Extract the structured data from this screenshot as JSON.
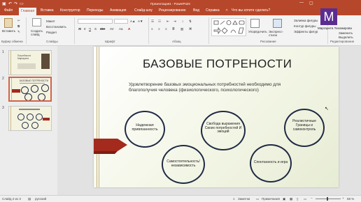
{
  "window": {
    "title": "Презентация1 - PowerPoint",
    "user": "Маргарита Тихомирова",
    "user_initial": "M"
  },
  "tabs": [
    {
      "label": "Файл"
    },
    {
      "label": "Главная"
    },
    {
      "label": "Вставка"
    },
    {
      "label": "Конструктор"
    },
    {
      "label": "Переходы"
    },
    {
      "label": "Анимация"
    },
    {
      "label": "Слайд-шоу"
    },
    {
      "label": "Рецензирование"
    },
    {
      "label": "Вид"
    },
    {
      "label": "Справка"
    },
    {
      "label": "Что вы хотите сделать?"
    }
  ],
  "ribbon": {
    "paste": "Вставить",
    "create_slide": "Создать слайд",
    "layout": "Макет",
    "reset": "Восстановить",
    "section": "Раздел",
    "arrange": "Упорядочить",
    "express_styles": "Экспресс-стили",
    "shape_fill": "Заливка фигуры",
    "shape_outline": "Контур фигуры",
    "shape_effects": "Эффекты фигур",
    "find": "Найти",
    "replace": "Заменить",
    "select": "Выделить",
    "groups": {
      "clipboard": "Буфер обмена",
      "slides": "Слайды",
      "font": "Шрифт",
      "paragraph": "Абзац",
      "drawing": "Рисование",
      "editing": "Редактирование"
    }
  },
  "thumbnails": [
    {
      "num": "1",
      "title": "Потребности Маргарита",
      "selected": false
    },
    {
      "num": "2",
      "title": "БАЗОВЫЕ ПОТРЕНОСТИ",
      "selected": true
    },
    {
      "num": "3",
      "title": "",
      "selected": false
    }
  ],
  "slide": {
    "title": "БАЗОВЫЕ ПОТРЕНОСТИ",
    "subtitle": "Удовлетворение базовых эмоциональных потребностей необходимо для благополучия человека (физиологического, психологического)",
    "circles": [
      {
        "text": "Надежная привязанность"
      },
      {
        "text": "Самостоятельность/ независимость"
      },
      {
        "text": "Свобода выражения Своих потребностей И эмоций"
      },
      {
        "text": "Спонтанность и игра"
      },
      {
        "text": "Реалистичные Границы и самоконтроль"
      }
    ]
  },
  "statusbar": {
    "slide_info": "Слайд 2 из 3",
    "language": "русский",
    "notes": "Заметки",
    "comments": "Примечания",
    "zoom": "68 %"
  },
  "colors": {
    "accent": "#b7472a",
    "arrow": "#a32a1c",
    "circle_border": "#1f2a44"
  }
}
